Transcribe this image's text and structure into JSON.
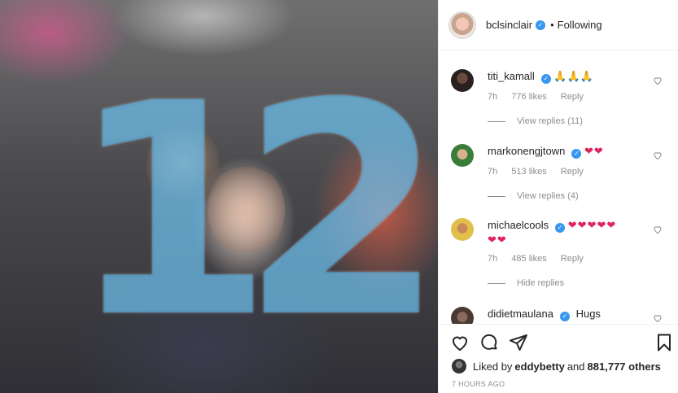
{
  "post": {
    "author": "bclsinclair",
    "separator": "•",
    "follow_status": "Following",
    "photo_overlay_text": "12"
  },
  "comments": [
    {
      "username": "titi_kamall",
      "text": "🙏🙏🙏",
      "hearts": "",
      "time": "7h",
      "likes": "776 likes",
      "reply_label": "Reply",
      "replies_toggle": "View replies (11)"
    },
    {
      "username": "markonengjtown",
      "text": "",
      "hearts": "❤❤",
      "time": "7h",
      "likes": "513 likes",
      "reply_label": "Reply",
      "replies_toggle": "View replies (4)"
    },
    {
      "username": "michaelcools",
      "text": "",
      "hearts": "❤❤❤❤❤",
      "hearts2": "❤❤",
      "time": "7h",
      "likes": "485 likes",
      "reply_label": "Reply",
      "replies_toggle": "Hide replies"
    },
    {
      "username": "didietmaulana",
      "text": "Hugs"
    }
  ],
  "likes_line": {
    "prefix": "Liked by ",
    "user": "eddybetty",
    "middle": " and ",
    "count": "881,777 others"
  },
  "timestamp": "7 HOURS AGO",
  "icons": {
    "like": "heart-outline-icon",
    "comment": "speech-bubble-icon",
    "share": "paper-plane-icon",
    "save": "bookmark-icon",
    "verified": "verified-badge-icon"
  },
  "colors": {
    "verified": "#3897f0",
    "heart_emoji": "#e0245e",
    "muted_text": "#8e8e8e",
    "border": "#efefef"
  }
}
